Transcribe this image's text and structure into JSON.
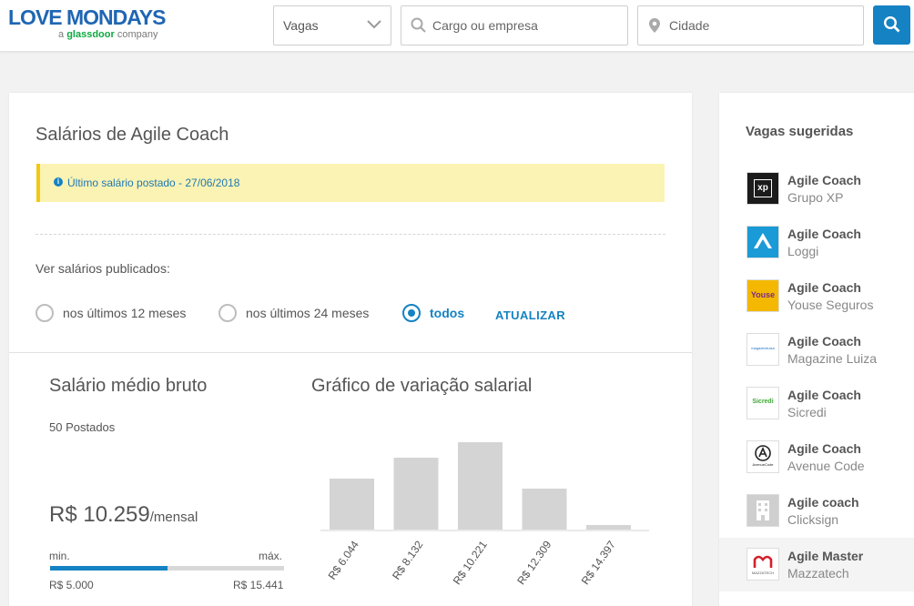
{
  "header": {
    "logo_main": "LOVE MONDAYS",
    "logo_sub_prefix": "a",
    "logo_sub_brand": "glassdoor",
    "logo_sub_suffix": "company",
    "select_value": "Vagas",
    "cargo_placeholder": "Cargo ou empresa",
    "cidade_placeholder": "Cidade",
    "icons": [
      "chevron-down-icon",
      "search-icon",
      "location-pin-icon",
      "search-icon"
    ],
    "accent_color": "#1582c3"
  },
  "main": {
    "title": "Salários de Agile Coach",
    "notice": "Último salário postado - 27/06/2018",
    "filter_label": "Ver salários publicados:",
    "radios": [
      {
        "label": "nos últimos 12 meses",
        "selected": false
      },
      {
        "label": "nos últimos 24 meses",
        "selected": false
      },
      {
        "label": "todos",
        "selected": true
      }
    ],
    "update_label": "ATUALIZAR",
    "summary": {
      "title": "Salário médio bruto",
      "count": "50 Postados",
      "amount": "R$ 10.259",
      "unit": "/mensal",
      "min_label": "min.",
      "max_label": "máx.",
      "min_value": "R$ 5.000",
      "max_value": "R$ 15.441",
      "position_fraction": 0.5
    },
    "chart_title": "Gráfico de variação salarial"
  },
  "chart_data": {
    "type": "bar",
    "categories": [
      "R$ 6.044",
      "R$ 8.132",
      "R$ 10.221",
      "R$ 12.309",
      "R$ 14.397"
    ],
    "values": [
      56,
      79,
      96,
      45,
      5
    ],
    "ylim": [
      0,
      100
    ],
    "bar_color": "#d4d4d4",
    "grid": false
  },
  "sidebar": {
    "title": "Vagas sugeridas",
    "jobs": [
      {
        "title": "Agile Coach",
        "company": "Grupo XP",
        "logo_text": "xp"
      },
      {
        "title": "Agile Coach",
        "company": "Loggi",
        "logo_text": ""
      },
      {
        "title": "Agile Coach",
        "company": "Youse Seguros",
        "logo_text": "Youse"
      },
      {
        "title": "Agile Coach",
        "company": "Magazine Luiza",
        "logo_text": "magazineluiza"
      },
      {
        "title": "Agile Coach",
        "company": "Sicredi",
        "logo_text": "Sicredi"
      },
      {
        "title": "Agile Coach",
        "company": "Avenue Code",
        "logo_text": "AvenueCode"
      },
      {
        "title": "Agile coach",
        "company": "Clicksign",
        "logo_text": ""
      },
      {
        "title": "Agile Master",
        "company": "Mazzatech",
        "logo_text": "MAZZATECH"
      }
    ]
  }
}
